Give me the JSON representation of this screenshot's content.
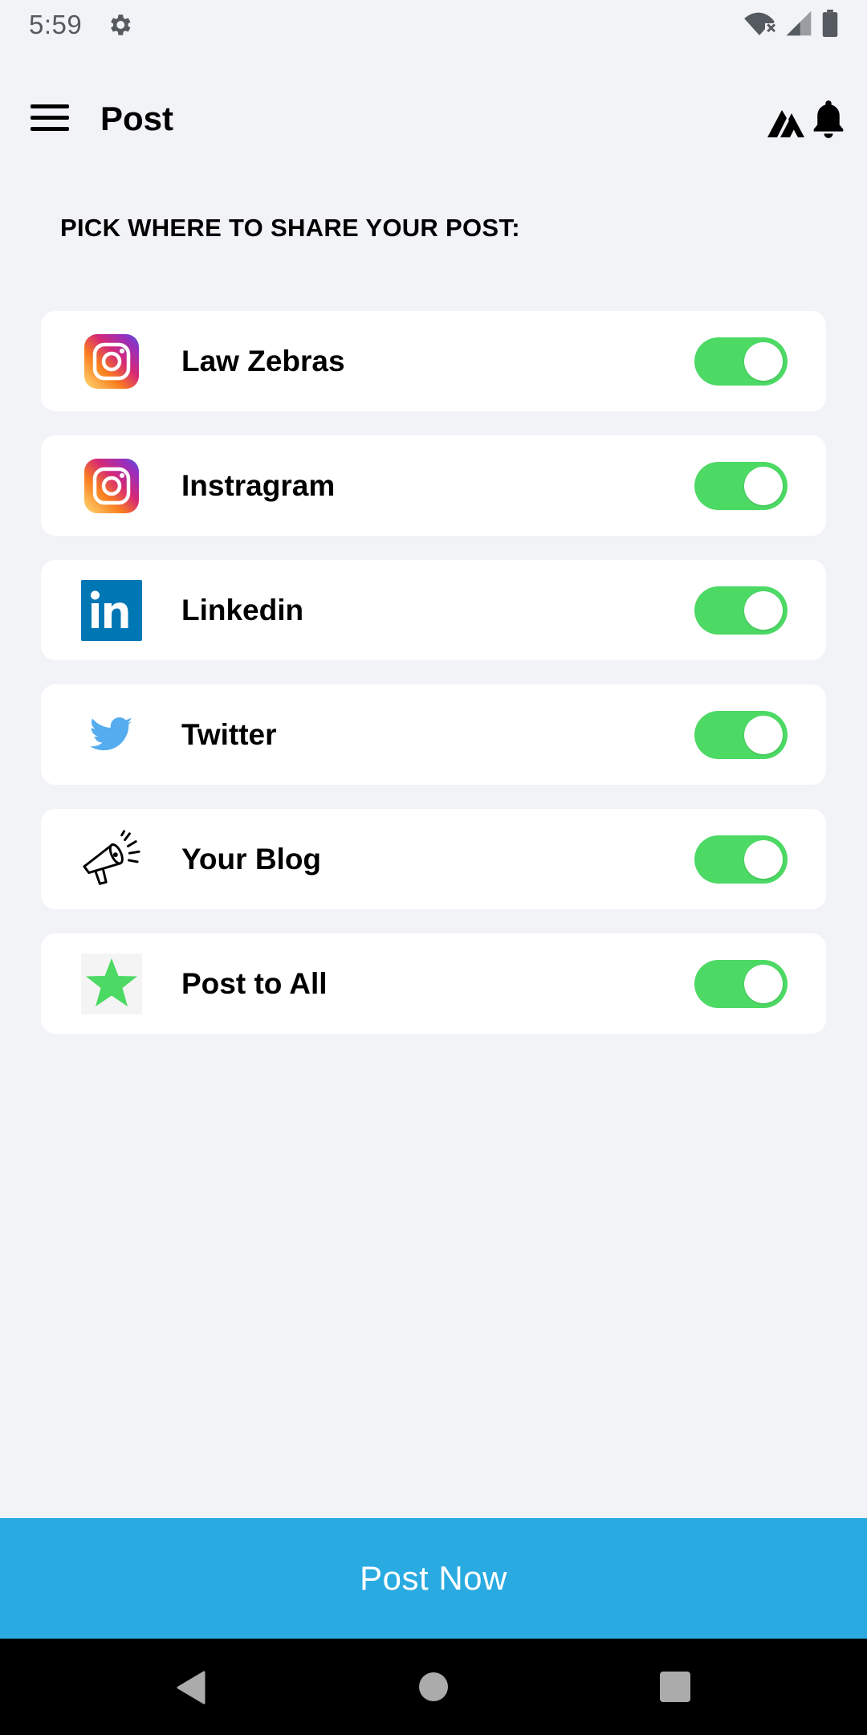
{
  "status_bar": {
    "time": "5:59"
  },
  "app_bar": {
    "title": "Post"
  },
  "section": {
    "heading": "PICK WHERE TO SHARE YOUR POST:"
  },
  "share_targets": [
    {
      "label": "Law Zebras",
      "icon": "instagram-icon",
      "enabled": true
    },
    {
      "label": "Instragram",
      "icon": "instagram-icon",
      "enabled": true
    },
    {
      "label": "Linkedin",
      "icon": "linkedin-icon",
      "enabled": true
    },
    {
      "label": "Twitter",
      "icon": "twitter-icon",
      "enabled": true
    },
    {
      "label": "Your Blog",
      "icon": "megaphone-icon",
      "enabled": true
    },
    {
      "label": "Post to All",
      "icon": "star-icon",
      "enabled": true
    }
  ],
  "footer": {
    "post_button_label": "Post Now"
  },
  "colors": {
    "background": "#f2f3f7",
    "toggle_on": "#4cd964",
    "post_button": "#29abe2",
    "linkedin": "#0077b5",
    "twitter": "#55acee",
    "star": "#4cd964"
  }
}
